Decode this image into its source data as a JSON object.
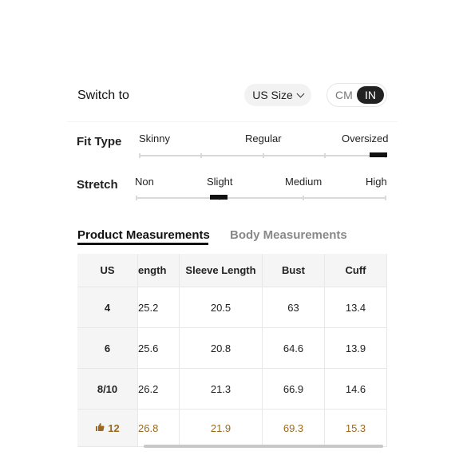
{
  "switch": {
    "label": "Switch to",
    "size_select": "US Size",
    "unit_cm": "CM",
    "unit_in": "IN"
  },
  "fit_type": {
    "label": "Fit Type",
    "options": [
      "Skinny",
      "Regular",
      "Oversized"
    ],
    "selected": "Oversized"
  },
  "stretch": {
    "label": "Stretch",
    "options": [
      "Non",
      "Slight",
      "Medium",
      "High"
    ],
    "selected": "Slight"
  },
  "tabs": {
    "product": "Product Measurements",
    "body": "Body Measurements",
    "active": "product"
  },
  "table": {
    "headers": [
      "US",
      "ength",
      "Sleeve Length",
      "Bust",
      "Cuff"
    ],
    "rows": [
      [
        "4",
        "25.2",
        "20.5",
        "63",
        "13.4"
      ],
      [
        "6",
        "25.6",
        "20.8",
        "64.6",
        "13.9"
      ],
      [
        "8/10",
        "26.2",
        "21.3",
        "66.9",
        "14.6"
      ],
      [
        "12",
        "26.8",
        "21.9",
        "69.3",
        "15.3"
      ]
    ],
    "recommended_row": 3,
    "highlight_color": "#9b6a1f"
  }
}
